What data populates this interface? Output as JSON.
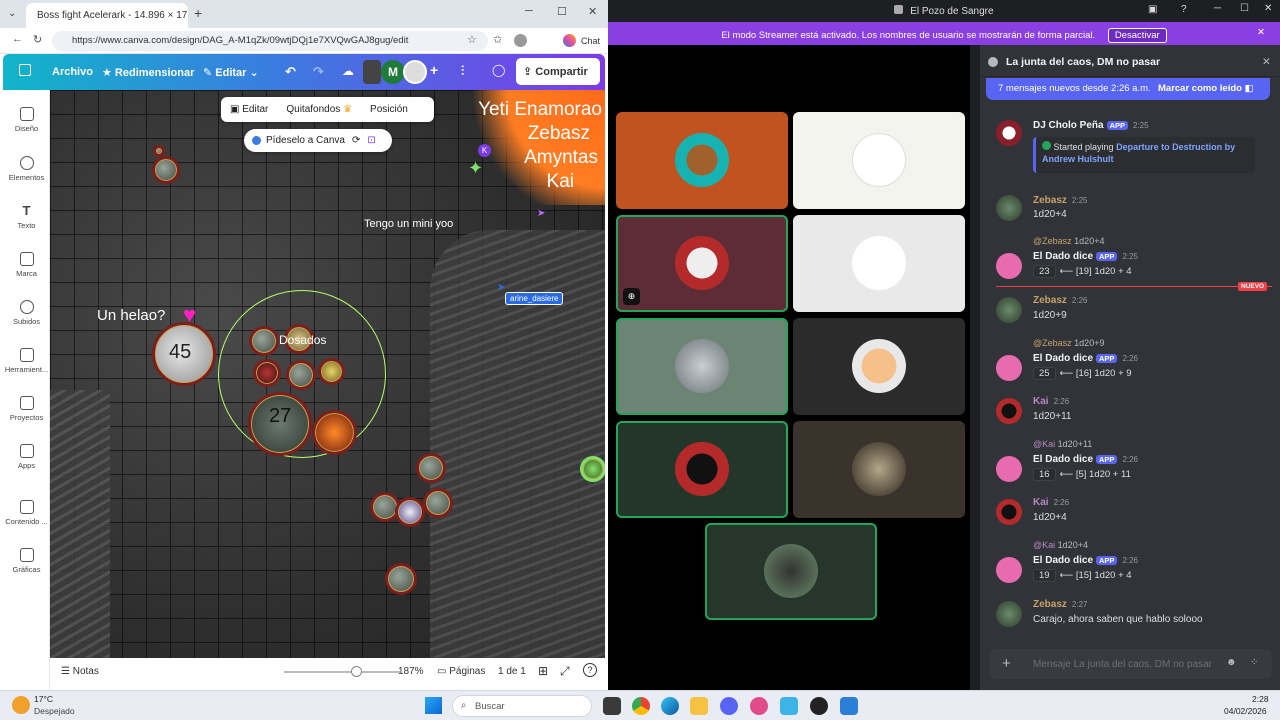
{
  "browser": {
    "tab_title": "Boss fight Acelerark - 14.896 × 17.",
    "url": "https://www.canva.com/design/DAG_A-M1qZk/09wtjDQj1e7XVQwGAJ8gug/edit",
    "copilot_label": "Chat"
  },
  "canva": {
    "file_label": "Archivo",
    "resize_label": "Redimensionar",
    "edit_label": "Editar",
    "avatar_letter": "M",
    "share_label": "Compartir",
    "sidebar": [
      {
        "label": "Diseño",
        "icon": "layout-icon"
      },
      {
        "label": "Elementos",
        "icon": "shapes-icon"
      },
      {
        "label": "Texto",
        "icon": "text-icon"
      },
      {
        "label": "Marca",
        "icon": "crown-icon"
      },
      {
        "label": "Subidos",
        "icon": "upload-icon"
      },
      {
        "label": "Herramient...",
        "icon": "pen-icon"
      },
      {
        "label": "Proyectos",
        "icon": "folder-icon"
      },
      {
        "label": "Apps",
        "icon": "apps-icon"
      },
      {
        "label": "Contenido ...",
        "icon": "magic-icon"
      },
      {
        "label": "Gráficas",
        "icon": "chart-icon"
      }
    ],
    "context_menu": {
      "edit": "Editar",
      "bg_remove": "Quitafondos",
      "position": "Posición"
    },
    "ask_canva": "Pídeselo a Canva",
    "map_texts": {
      "names": [
        "Yeti Enamorao",
        "Zebasz",
        "Amyntas",
        "Kai"
      ],
      "mini_yoo": "Tengo un mini yoo",
      "helao": "Un helao?",
      "token_45": "45",
      "token_27": "27",
      "dos": "Dos",
      "dos_suffix": "ados",
      "cursor_user": "arine_dasiere",
      "cursor_k": "K"
    },
    "bottom": {
      "notes": "Notas",
      "zoom": "187%",
      "pages": "Páginas",
      "page_count": "1 de 1",
      "zoom_level": 0.62
    }
  },
  "discord": {
    "window_title": "El Pozo de Sangre",
    "streamer_notice": "El modo Streamer está activado. Los nombres de usuario se mostrarán de forma parcial.",
    "streamer_button": "Desactivar",
    "channel_title": "La junta del caos, DM no pasar",
    "new_messages": "7 mensajes nuevos desde 2:26 a.m.",
    "mark_read": "Marcar como leído",
    "new_tag": "NUEVO",
    "composer_placeholder": "Mensaje La junta del caos, DM no pasar",
    "app_tag": "APP",
    "messages": {
      "dj": {
        "name": "DJ Cholo Peña",
        "time": "2:25",
        "playing_prefix": "Started playing",
        "track": "Departure to Destruction by Andrew Hulshult"
      },
      "z1": {
        "name": "Zebasz",
        "time": "2:25",
        "text": "1d20+4"
      },
      "d1": {
        "reply_user": "@Zebasz",
        "reply_text": "1d20+4",
        "name": "El Dado dice",
        "time": "2:25",
        "total": "23",
        "detail": "⟵ [19] 1d20 + 4"
      },
      "z2": {
        "name": "Zebasz",
        "time": "2:26",
        "text": "1d20+9"
      },
      "d2": {
        "reply_user": "@Zebasz",
        "reply_text": "1d20+9",
        "name": "El Dado dice",
        "time": "2:26",
        "total": "25",
        "detail": "⟵ [16] 1d20 + 9"
      },
      "k1": {
        "name": "Kai",
        "time": "2:26",
        "text": "1d20+11"
      },
      "d3": {
        "reply_user": "@Kai",
        "reply_text": "1d20+11",
        "name": "El Dado dice",
        "time": "2:26",
        "total": "16",
        "detail": "⟵ [5] 1d20 + 11"
      },
      "k2": {
        "name": "Kai",
        "time": "2:26",
        "text": "1d20+4"
      },
      "d4": {
        "reply_user": "@Kai",
        "reply_text": "1d20+4",
        "name": "El Dado dice",
        "time": "2:26",
        "total": "19",
        "detail": "⟵ [15] 1d20 + 4"
      },
      "z3": {
        "name": "Zebasz",
        "time": "2:27",
        "text": "Carajo, ahora saben que hablo solooo"
      }
    }
  },
  "taskbar": {
    "temp": "17°C",
    "weather": "Despejado",
    "search": "Buscar",
    "time": "2:28",
    "date": "04/02/2026"
  },
  "colors": {
    "discord_bg": "#313338",
    "blurple": "#5865f2",
    "streamer_purple": "#8a3fe3",
    "speaking_green": "#23a55a",
    "name_green": "#c5a46b"
  }
}
